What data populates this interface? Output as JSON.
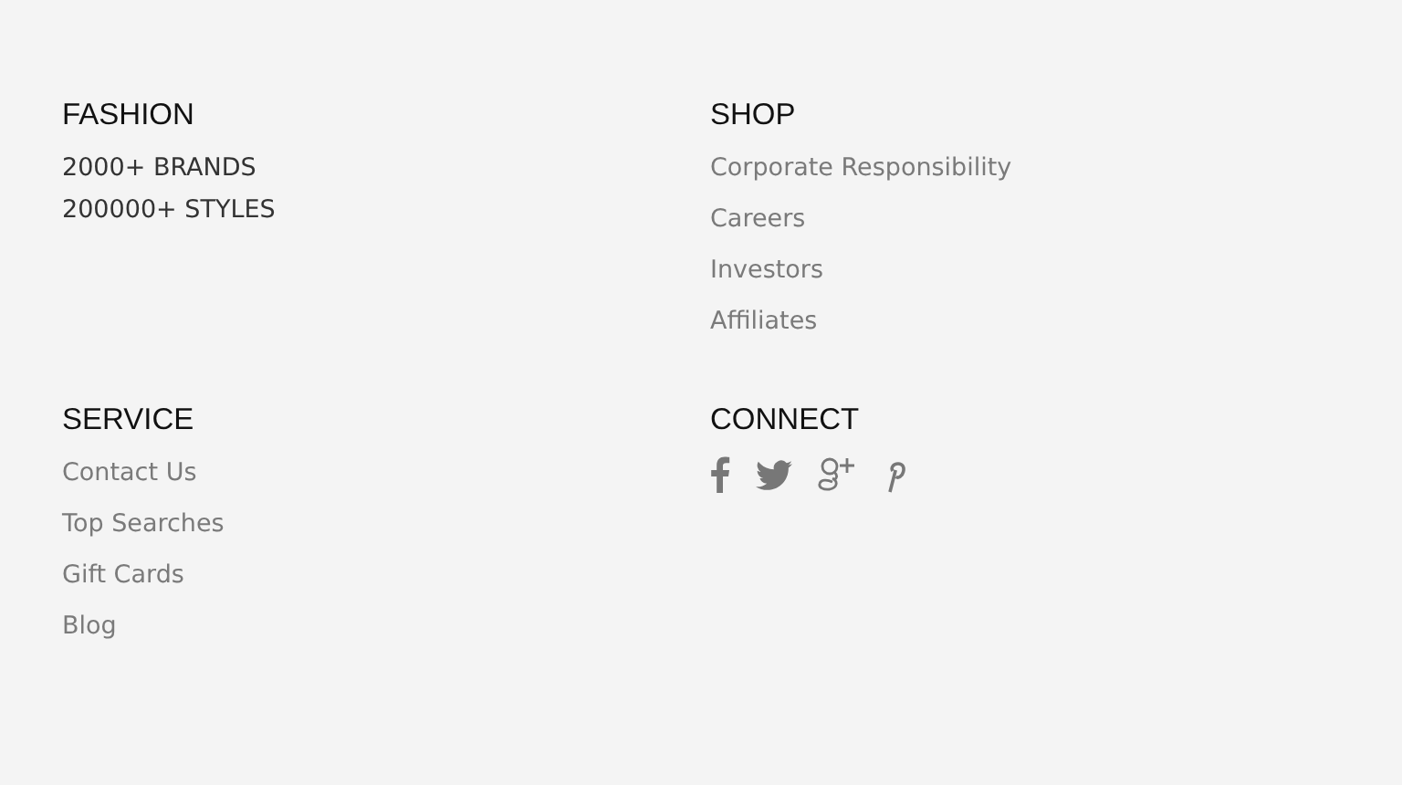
{
  "sections": [
    {
      "heading": "FASHION",
      "kind": "text",
      "items": [
        "2000+ BRANDS",
        "200000+ STYLES"
      ]
    },
    {
      "heading": "SHOP",
      "kind": "links",
      "items": [
        "Corporate Responsibility",
        "Careers",
        "Investors",
        "Affiliates"
      ]
    },
    {
      "heading": "SERVICE",
      "kind": "links",
      "items": [
        "Contact Us",
        "Top Searches",
        "Gift Cards",
        "Blog"
      ]
    },
    {
      "heading": "CONNECT",
      "kind": "social"
    }
  ]
}
